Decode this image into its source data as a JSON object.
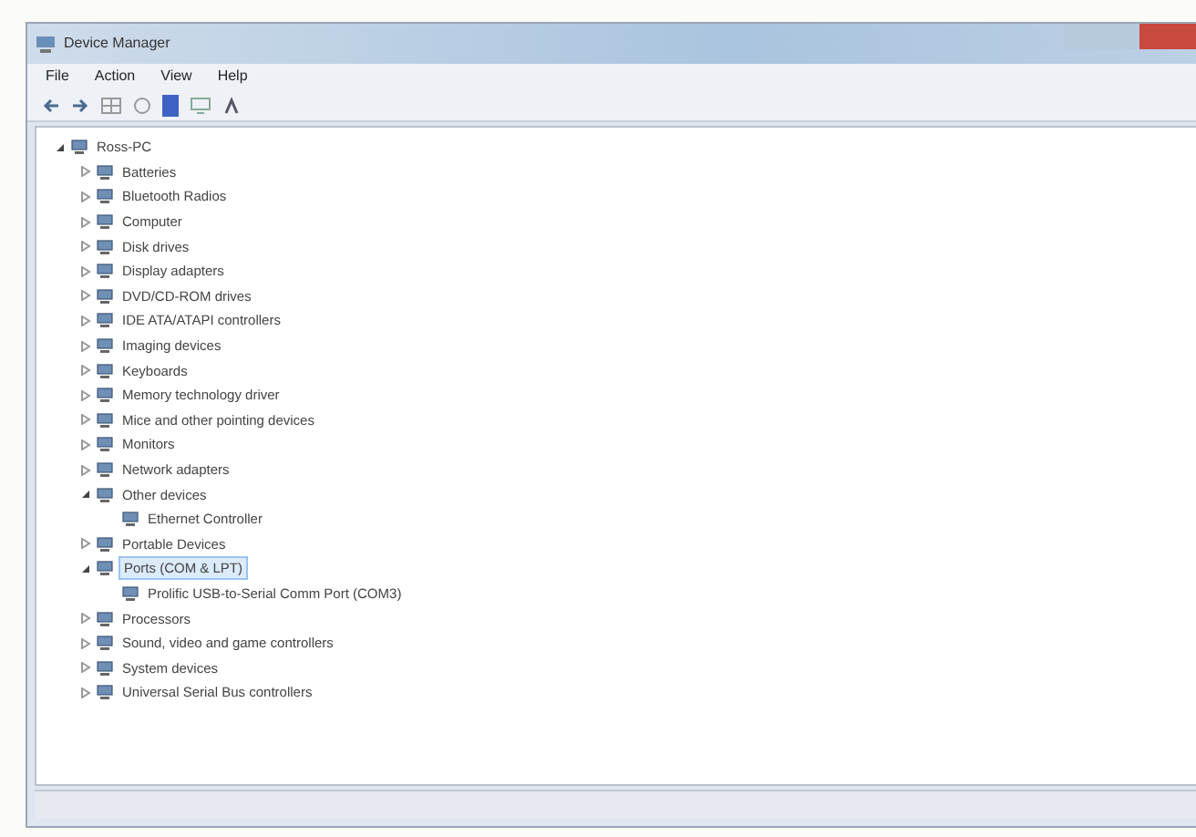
{
  "window": {
    "title": "Device Manager"
  },
  "menu": [
    {
      "label": "File"
    },
    {
      "label": "Action"
    },
    {
      "label": "View"
    },
    {
      "label": "Help"
    }
  ],
  "tree": {
    "label": "Ross-PC",
    "expanded": true,
    "selected": false,
    "children": [
      {
        "label": "Batteries",
        "expanded": false,
        "selected": false
      },
      {
        "label": "Bluetooth Radios",
        "expanded": false,
        "selected": false
      },
      {
        "label": "Computer",
        "expanded": false,
        "selected": false
      },
      {
        "label": "Disk drives",
        "expanded": false,
        "selected": false
      },
      {
        "label": "Display adapters",
        "expanded": false,
        "selected": false
      },
      {
        "label": "DVD/CD-ROM drives",
        "expanded": false,
        "selected": false
      },
      {
        "label": "IDE ATA/ATAPI controllers",
        "expanded": false,
        "selected": false
      },
      {
        "label": "Imaging devices",
        "expanded": false,
        "selected": false
      },
      {
        "label": "Keyboards",
        "expanded": false,
        "selected": false
      },
      {
        "label": "Memory technology driver",
        "expanded": false,
        "selected": false
      },
      {
        "label": "Mice and other pointing devices",
        "expanded": false,
        "selected": false
      },
      {
        "label": "Monitors",
        "expanded": false,
        "selected": false
      },
      {
        "label": "Network adapters",
        "expanded": false,
        "selected": false
      },
      {
        "label": "Other devices",
        "expanded": true,
        "selected": false,
        "children": [
          {
            "label": "Ethernet Controller",
            "selected": false
          }
        ]
      },
      {
        "label": "Portable Devices",
        "expanded": false,
        "selected": false
      },
      {
        "label": "Ports (COM & LPT)",
        "expanded": true,
        "selected": true,
        "children": [
          {
            "label": "Prolific USB-to-Serial Comm Port (COM3)",
            "selected": false
          }
        ]
      },
      {
        "label": "Processors",
        "expanded": false,
        "selected": false
      },
      {
        "label": "Sound, video and game controllers",
        "expanded": false,
        "selected": false
      },
      {
        "label": "System devices",
        "expanded": false,
        "selected": false
      },
      {
        "label": "Universal Serial Bus controllers",
        "expanded": false,
        "selected": false
      }
    ]
  }
}
